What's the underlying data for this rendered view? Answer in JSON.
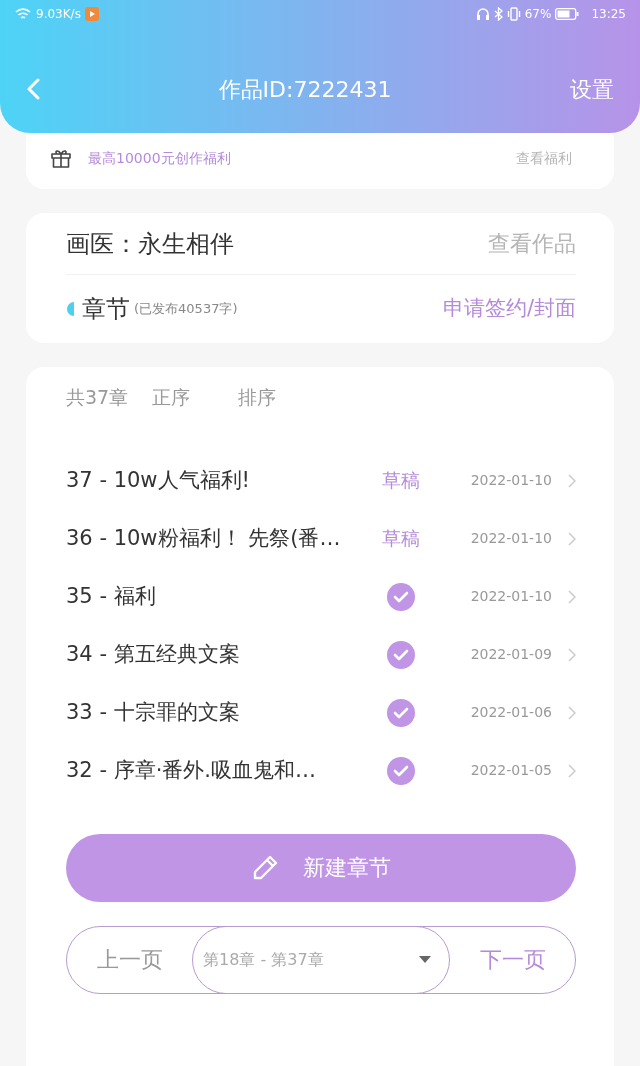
{
  "status_bar": {
    "speed": "9.03K/s",
    "battery": "67%",
    "time": "13:25"
  },
  "header": {
    "title": "作品ID:7222431",
    "action": "设置"
  },
  "welfare": {
    "text": "最高10000元创作福利",
    "link": "查看福利"
  },
  "work": {
    "title": "画医：永生相伴",
    "link": "查看作品",
    "section": "章节",
    "published": "(已发布40537字)",
    "action": "申请签约/封面"
  },
  "list_header": {
    "count": "共37章",
    "order": "正序",
    "sort": "排序"
  },
  "chapters": [
    {
      "title": "37 - 10w人气福利!",
      "kind": "draft",
      "status": "草稿",
      "date": "2022-01-10"
    },
    {
      "title": "36 - 10w粉福利！ 先祭(番…",
      "kind": "draft",
      "status": "草稿",
      "date": "2022-01-10"
    },
    {
      "title": "35 - 福利",
      "kind": "published",
      "date": "2022-01-10"
    },
    {
      "title": "34 - 第五经典文案",
      "kind": "published",
      "date": "2022-01-09"
    },
    {
      "title": "33 - 十宗罪的文案",
      "kind": "published",
      "date": "2022-01-06"
    },
    {
      "title": "32 - 序章·番外.吸血鬼和…",
      "kind": "published",
      "date": "2022-01-05"
    }
  ],
  "new_button": "新建章节",
  "pager": {
    "prev": {
      "label": "上一页",
      "disabled": true
    },
    "range": "第18章 - 第37章",
    "next": {
      "label": "下一页",
      "disabled": false
    }
  }
}
